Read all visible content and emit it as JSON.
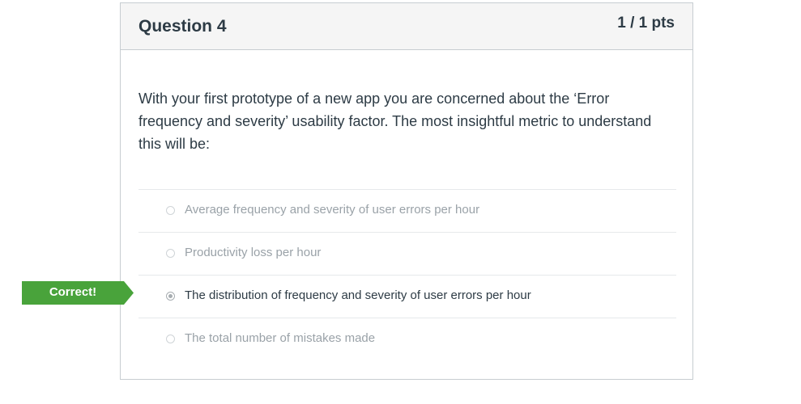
{
  "question": {
    "title": "Question 4",
    "points": "1 / 1 pts",
    "text": "With your first prototype of a new app you are concerned about the ‘Error frequency and severity’ usability factor. The most insightful metric to understand this will be:"
  },
  "answers": [
    {
      "label": "Average frequency and severity of user errors per hour",
      "selected": false
    },
    {
      "label": "Productivity loss per hour",
      "selected": false
    },
    {
      "label": "The distribution of frequency and severity of user errors per hour",
      "selected": true
    },
    {
      "label": "The total number of mistakes made",
      "selected": false
    }
  ],
  "feedback": {
    "correct_label": "Correct!",
    "color": "#49a33b"
  }
}
